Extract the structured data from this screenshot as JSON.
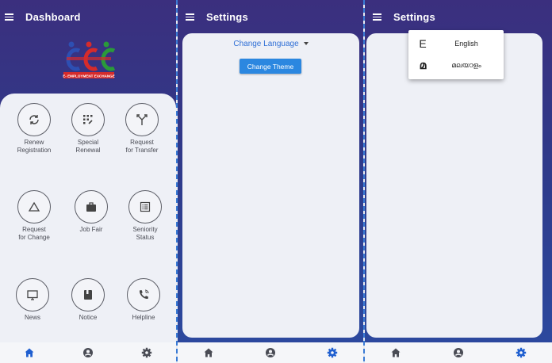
{
  "dashboard": {
    "title": "Dashboard",
    "logo_text": "E- EMPLOYMENT EXCHANGE",
    "tiles": [
      {
        "label": "Renew\nRegistration",
        "icon": "refresh-icon"
      },
      {
        "label": "Special\nRenewal",
        "icon": "grid-icon"
      },
      {
        "label": "Request\nfor Transfer",
        "icon": "fork-icon"
      },
      {
        "label": "Request\nfor Change",
        "icon": "triangle-icon"
      },
      {
        "label": "Job Fair",
        "icon": "briefcase-icon"
      },
      {
        "label": "Seniority\nStatus",
        "icon": "list-icon"
      },
      {
        "label": "News",
        "icon": "monitor-icon"
      },
      {
        "label": "Notice",
        "icon": "book-icon"
      },
      {
        "label": "Helpline",
        "icon": "phone-icon"
      }
    ]
  },
  "settings": {
    "title": "Settings",
    "change_language": "Change Language",
    "change_theme": "Change Theme",
    "languages": [
      {
        "glyph": "E",
        "name": "English"
      },
      {
        "glyph": " മ",
        "name": "മലയാളം"
      }
    ]
  },
  "nav": {
    "items": [
      "home-icon",
      "account-icon",
      "settings-icon"
    ]
  },
  "colors": {
    "accent": "#2b87e0",
    "active_nav": "#1f5fd0",
    "inactive_nav": "#4a4c55"
  }
}
